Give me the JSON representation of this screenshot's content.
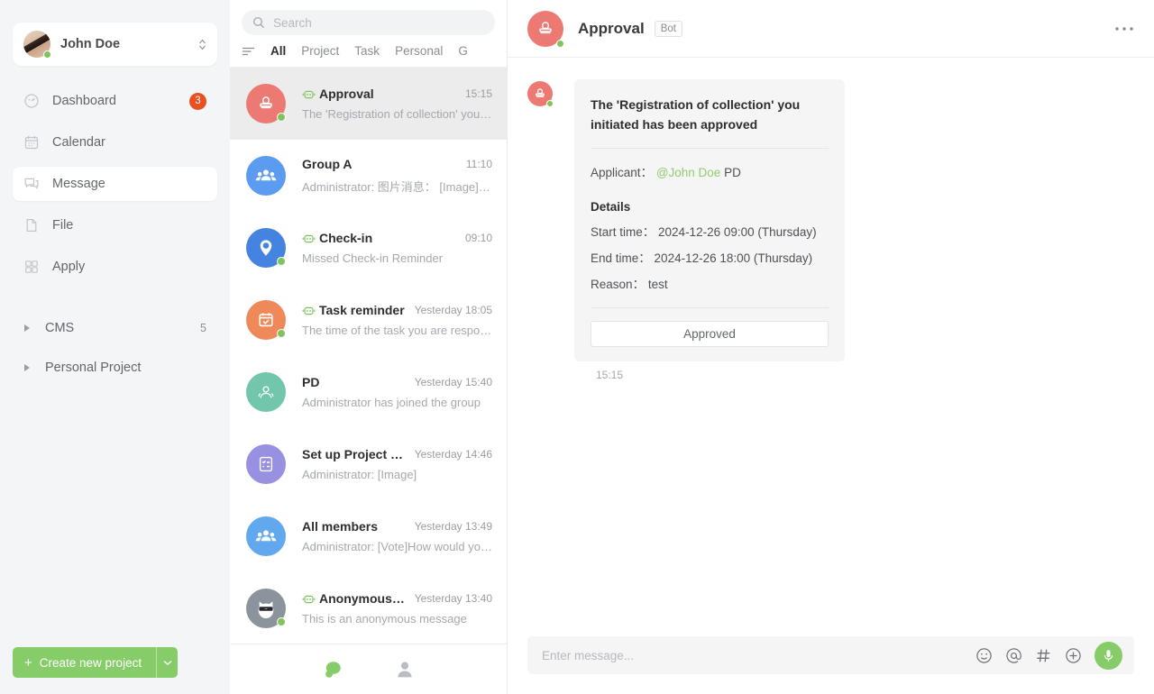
{
  "sidebar": {
    "profile": {
      "name": "John Doe",
      "status": "online"
    },
    "nav": [
      {
        "label": "Dashboard",
        "icon": "gauge-icon",
        "badge": "3",
        "active": false
      },
      {
        "label": "Calendar",
        "icon": "calendar-icon",
        "badge": "",
        "active": false
      },
      {
        "label": "Message",
        "icon": "message-icon",
        "badge": "",
        "active": true
      },
      {
        "label": "File",
        "icon": "file-icon",
        "badge": "",
        "active": false
      },
      {
        "label": "Apply",
        "icon": "grid-icon",
        "badge": "",
        "active": false
      }
    ],
    "groups": [
      {
        "label": "CMS",
        "count": "5"
      },
      {
        "label": "Personal Project",
        "count": ""
      }
    ],
    "create_button": {
      "label": "Create new project",
      "plus": "+"
    }
  },
  "list_panel": {
    "search": {
      "placeholder": "Search",
      "value": ""
    },
    "filters": [
      {
        "label": "All",
        "active": true
      },
      {
        "label": "Project",
        "active": false
      },
      {
        "label": "Task",
        "active": false
      },
      {
        "label": "Personal",
        "active": false
      },
      {
        "label": "G",
        "active": false
      }
    ],
    "conversations": [
      {
        "title": "Approval",
        "time": "15:15",
        "preview": "The 'Registration of collection' you ini…",
        "bot": true,
        "online": true,
        "avatar": "stamp-icon",
        "color": "#ec7a72",
        "active": true
      },
      {
        "title": "Group A",
        "time": "11:10",
        "preview": "Administrator: 图片消息：  [Image][Im…",
        "bot": false,
        "online": false,
        "avatar": "group-icon",
        "color": "#5b9bf0",
        "active": false
      },
      {
        "title": "Check-in",
        "time": "09:10",
        "preview": "Missed Check-in Reminder",
        "bot": true,
        "online": true,
        "avatar": "location-icon",
        "color": "#4583e0",
        "active": false
      },
      {
        "title": "Task reminder",
        "time": "Yesterday 18:05",
        "preview": "The time of the task you are responsi…",
        "bot": true,
        "online": true,
        "avatar": "calendar-check-icon",
        "color": "#f0895a",
        "active": false
      },
      {
        "title": "PD",
        "time": "Yesterday 15:40",
        "preview": "Administrator has joined the group",
        "bot": false,
        "online": false,
        "avatar": "person-outline-icon",
        "color": "#72c6ab",
        "active": false
      },
      {
        "title": "Set up Project Re…",
        "time": "Yesterday 14:46",
        "preview": "Administrator: [Image]",
        "bot": false,
        "online": false,
        "avatar": "checklist-icon",
        "color": "#9890e0",
        "active": false
      },
      {
        "title": "All members",
        "time": "Yesterday 13:49",
        "preview": "Administrator: [Vote]How would you r…",
        "bot": false,
        "online": false,
        "avatar": "group-icon",
        "color": "#61a8ef",
        "active": false
      },
      {
        "title": "Anonymous M…",
        "time": "Yesterday 13:40",
        "preview": "This is an anonymous message",
        "bot": true,
        "online": true,
        "avatar": "cat-sunglasses-icon",
        "color": "#8b949c",
        "active": false
      }
    ],
    "tabbar": [
      {
        "icon": "chat-bubble-icon",
        "active": true
      },
      {
        "icon": "contacts-icon",
        "active": false
      }
    ]
  },
  "chat": {
    "header": {
      "title": "Approval",
      "bot_tag": "Bot",
      "avatar": "stamp-icon",
      "online": true
    },
    "message": {
      "heading": "The 'Registration of collection' you initiated has been approved",
      "applicant_label": "Applicant：",
      "applicant_mention": "@John Doe",
      "applicant_org": "PD",
      "details_label": "Details",
      "start_time_label": "Start time：",
      "start_time_value": "2024-12-26 09:00 (Thursday)",
      "end_time_label": "End time：",
      "end_time_value": "2024-12-26 18:00 (Thursday)",
      "reason_label": "Reason：",
      "reason_value": "test",
      "action_label": "Approved",
      "timestamp": "15:15"
    },
    "composer": {
      "placeholder": "Enter message...",
      "value": "",
      "icons": [
        "emoji-icon",
        "mention-icon",
        "hash-icon",
        "plus-circle-icon",
        "microphone-icon"
      ]
    }
  },
  "colors": {
    "accent_green": "#86cc68",
    "badge_red": "#e8501f",
    "mention_green": "#8fce70"
  }
}
